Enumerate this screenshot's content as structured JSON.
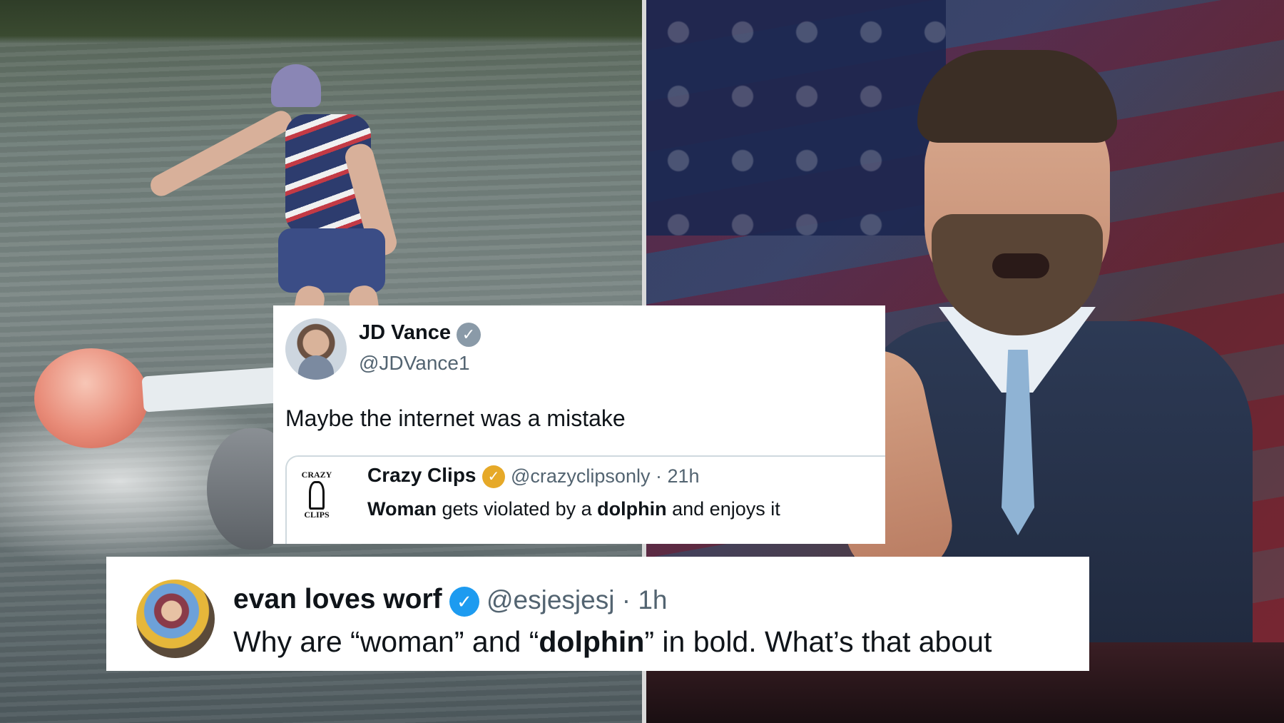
{
  "tweet_main": {
    "display_name": "JD Vance",
    "verified_badge": "✓",
    "handle": "@JDVance1",
    "text": "Maybe the internet was a mistake",
    "quoted": {
      "avatar_top": "CRAZY",
      "avatar_bottom": "CLIPS",
      "display_name": "Crazy Clips",
      "verified_badge": "✓",
      "handle_time": "@crazyclipsonly · 21h",
      "text_part1": "Woman",
      "text_part2": " gets violated by a ",
      "text_part3": "dolphin",
      "text_part4": " and enjoys it"
    }
  },
  "tweet_reply": {
    "display_name": "evan loves worf",
    "verified_badge": "✓",
    "handle_time": "@esjesjesj · 1h",
    "text_part1": "Why are “woman” and “",
    "text_part2": "dolphin",
    "text_part3": "” in bold. What’s that about"
  },
  "colors": {
    "verified_grey": "#8a9aa8",
    "verified_gold": "#e6a928",
    "verified_blue": "#1d9bf0"
  },
  "icons": [
    "verified-badge-icon"
  ]
}
